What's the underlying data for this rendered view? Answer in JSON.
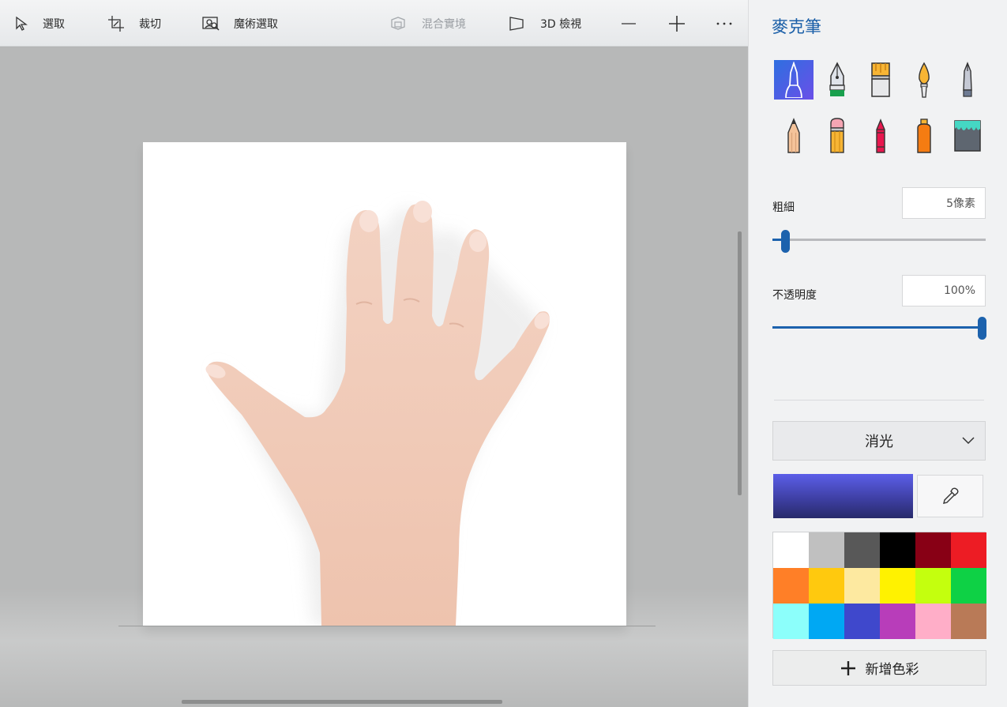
{
  "toolbar": {
    "select_label": "選取",
    "crop_label": "裁切",
    "magic_select_label": "魔術選取",
    "mixed_reality_label": "混合實境",
    "view3d_label": "3D 檢視"
  },
  "panel": {
    "title": "麥克筆",
    "brushes": [
      "marker",
      "calligraphy-pen-1",
      "oil-brush",
      "watercolor",
      "calligraphy-pen-2",
      "pencil",
      "eraser",
      "crayon",
      "spray-can",
      "fill-bucket"
    ],
    "selected_brush": "marker",
    "thickness_label": "粗細",
    "thickness_value": "5像素",
    "thickness_level": 0.06,
    "opacity_label": "不透明度",
    "opacity_value": "100%",
    "opacity_level": 1.0,
    "finish_label": "消光",
    "current_color": "#4a4dc9",
    "palette": [
      "#ffffff",
      "#c0c0c0",
      "#585858",
      "#000000",
      "#880015",
      "#ed1c24",
      "#ff7f27",
      "#ffc90e",
      "#fde9a0",
      "#fff200",
      "#c4ff0e",
      "#0ed145",
      "#8cfffb",
      "#00a8f3",
      "#3f48cc",
      "#b83dba",
      "#ffaec8",
      "#b97a57"
    ],
    "add_color_label": "新增色彩"
  },
  "colors": {
    "accent": "#1c62ad",
    "title": "#1a5fa8"
  }
}
